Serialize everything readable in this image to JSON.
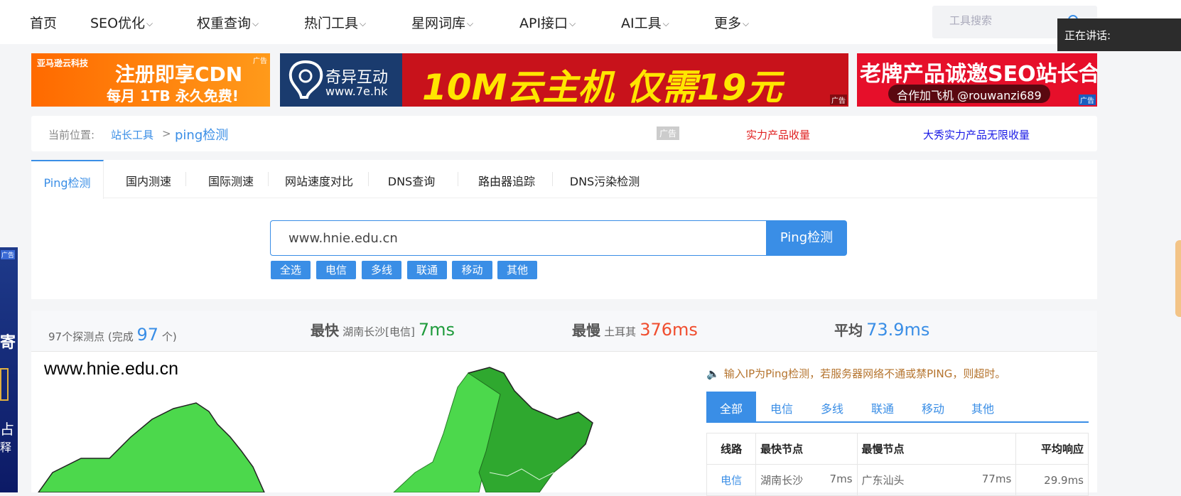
{
  "nav": {
    "items": [
      {
        "label": "首页",
        "has_dropdown": false
      },
      {
        "label": "SEO优化",
        "has_dropdown": true
      },
      {
        "label": "权重查询",
        "has_dropdown": true
      },
      {
        "label": "热门工具",
        "has_dropdown": true
      },
      {
        "label": "星网词库",
        "has_dropdown": true
      },
      {
        "label": "API接口",
        "has_dropdown": true
      },
      {
        "label": "AI工具",
        "has_dropdown": true
      },
      {
        "label": "更多",
        "has_dropdown": true
      }
    ],
    "search_placeholder": "工具搜索",
    "speaking_tip": "正在讲话:"
  },
  "banners": {
    "b1_top": "亚马逊云科技",
    "b1_main": "注册即享CDN",
    "b1_sub": "每月 1TB 永久免费!",
    "b2_brand": "奇异互动",
    "b2_url": "www.7e.hk",
    "b2_main": "10M云主机 仅需19元",
    "b3_main": "老牌产品诚邀SEO站长合作",
    "b3_sub": "合作加飞机 @rouwanzi689",
    "ad_label": "广告"
  },
  "breadcrumb": {
    "prefix": "当前位置:",
    "parent": "站长工具",
    "sep": ">",
    "current": "ping检测",
    "ad_label": "广告",
    "ad_link1": "实力产品收量",
    "ad_link2": "大秀实力产品无限收量"
  },
  "tabs": [
    "Ping检测",
    "国内测速",
    "国际测速",
    "网站速度对比",
    "DNS查询",
    "路由器追踪",
    "DNS污染检测"
  ],
  "ping": {
    "input_value": "www.hnie.edu.cn",
    "button_label": "Ping检测",
    "chips": [
      "全选",
      "电信",
      "多线",
      "联通",
      "移动",
      "其他"
    ]
  },
  "stats": {
    "nodes_prefix": "97个探测点 (完成",
    "nodes_done": "97",
    "nodes_suffix": "个)",
    "fastest_label": "最快",
    "fastest_loc": "湖南长沙[电信]",
    "fastest_value": "7ms",
    "slowest_label": "最慢",
    "slowest_loc": "土耳其",
    "slowest_value": "376ms",
    "avg_label": "平均",
    "avg_value": "73.9ms"
  },
  "map": {
    "title": "www.hnie.edu.cn"
  },
  "results": {
    "notice": "输入IP为Ping检测，若服务器网络不通或禁PING，则超时。",
    "tabs": [
      "全部",
      "电信",
      "多线",
      "联通",
      "移动",
      "其他"
    ],
    "headers": [
      "线路",
      "最快节点",
      "最慢节点",
      "平均响应"
    ],
    "rows": [
      {
        "line": "电信",
        "fast_node": "湖南长沙",
        "fast_ms": "7ms",
        "slow_node": "广东汕头",
        "slow_ms": "77ms",
        "avg": "29.9ms"
      }
    ]
  },
  "left_ad": {
    "ad_label": "广告",
    "glyph1": "释",
    "glyph2": "占",
    "glyph3": "寄"
  },
  "colors": {
    "accent": "#3a8ee6",
    "fast_green": "#1f9b3c",
    "slow_red": "#f04d2e",
    "map_green": "#4cd84c",
    "map_dark_green": "#2fa82f"
  }
}
